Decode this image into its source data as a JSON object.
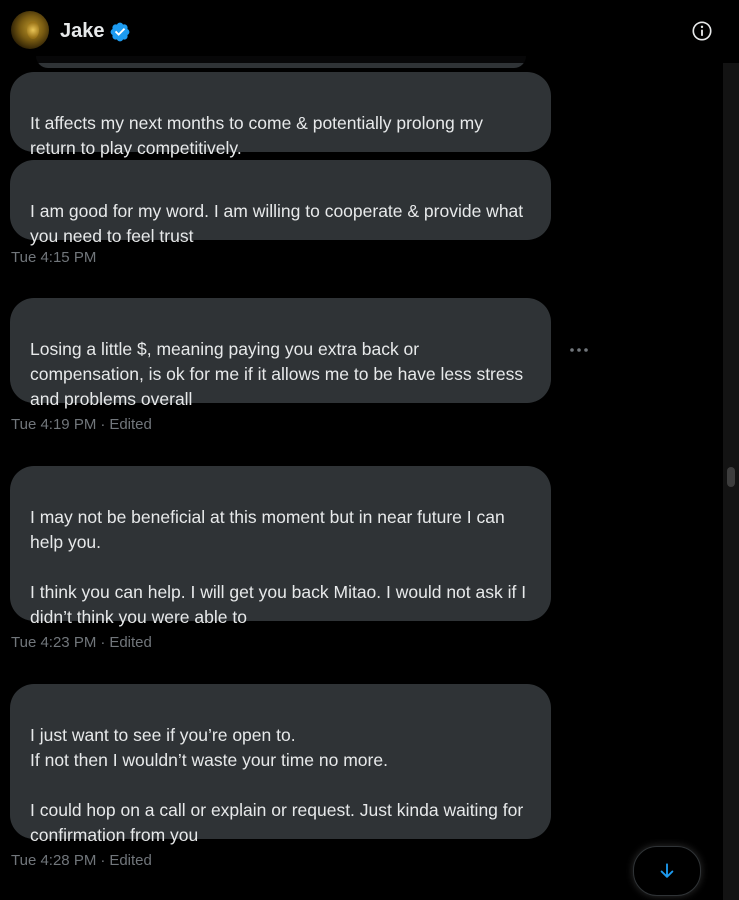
{
  "header": {
    "name": "Jake",
    "verified_icon": "verified-badge-icon",
    "info_icon": "info-icon"
  },
  "messages": [
    {
      "text": "It affects my next months to come & potentially prolong my return to play competitively."
    },
    {
      "text": "I am good for my word. I am willing to cooperate & provide what you need to feel trust"
    },
    {
      "text": "Losing a little $, meaning paying you extra back or compensation, is ok for me if it allows me to be have less stress and problems overall"
    },
    {
      "text": "I may not be beneficial at this moment but in near future I can help you.\n\nI think you can help. I will get you back Mitao. I would not ask if I didn’t think you were able to"
    },
    {
      "text": "I just want to see if you’re open to.\nIf not then I wouldn’t waste your time no more.\n\nI could hop on a call or explain or request. Just kinda waiting for confirmation from you"
    }
  ],
  "timestamps": [
    {
      "time": "Tue 4:15 PM",
      "edited": ""
    },
    {
      "time": "Tue 4:19 PM",
      "edited": "Edited",
      "sep": "·"
    },
    {
      "time": "Tue 4:23 PM",
      "edited": "Edited",
      "sep": "·"
    },
    {
      "time": "Tue 4:28 PM",
      "edited": "Edited",
      "sep": "·"
    }
  ],
  "icons": {
    "more": "more-options-icon",
    "scroll_down": "arrow-down-icon"
  },
  "colors": {
    "background": "#000000",
    "bubble": "#2f3336",
    "text": "#e7e9ea",
    "meta": "#71767b",
    "verified": "#1d9bf0",
    "accent": "#1d9bf0"
  }
}
